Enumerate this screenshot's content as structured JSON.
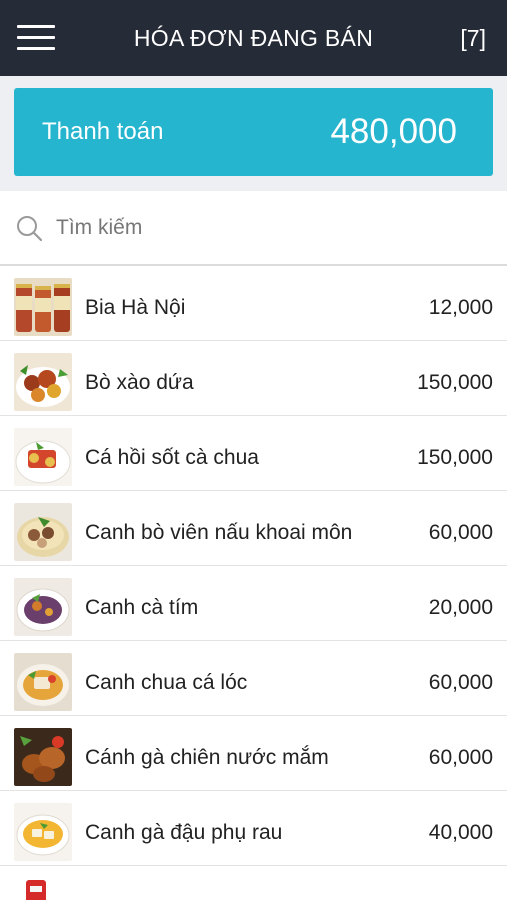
{
  "header": {
    "title": "HÓA ĐƠN ĐANG BÁN",
    "count": "[7]",
    "menu_icon": "hamburger-menu-icon"
  },
  "payment": {
    "label": "Thanh toán",
    "amount": "480,000",
    "color": "#26b5cf"
  },
  "search": {
    "placeholder": "Tìm kiếm",
    "value": "",
    "icon": "search-icon"
  },
  "items": [
    {
      "name": "Bia Hà Nội",
      "price": "12,000"
    },
    {
      "name": "Bò xào dứa",
      "price": "150,000"
    },
    {
      "name": "Cá hồi sốt cà chua",
      "price": "150,000"
    },
    {
      "name": "Canh bò viên nấu khoai môn",
      "price": "60,000"
    },
    {
      "name": "Canh cà tím",
      "price": "20,000"
    },
    {
      "name": "Canh chua cá lóc",
      "price": "60,000"
    },
    {
      "name": "Cánh gà chiên nước mắm",
      "price": "60,000"
    },
    {
      "name": "Canh gà đậu phụ rau",
      "price": "40,000"
    },
    {
      "name": "",
      "price": ""
    }
  ],
  "colors": {
    "header_bg": "#262b38",
    "accent": "#26b5cf"
  }
}
